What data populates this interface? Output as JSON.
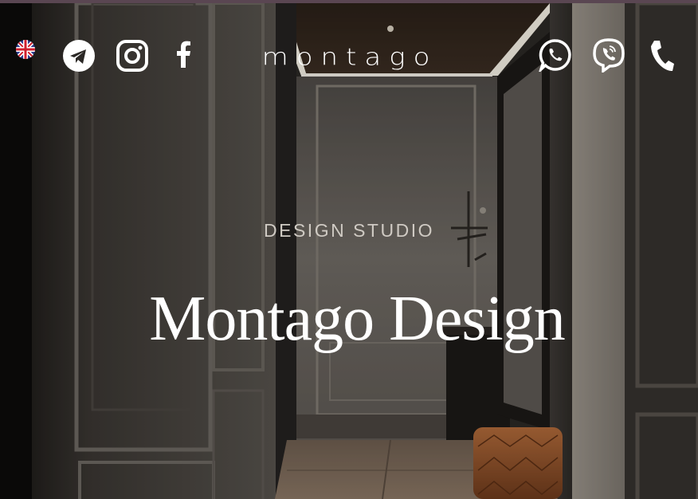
{
  "header": {
    "language": {
      "code": "en",
      "icon": "uk-flag-icon"
    },
    "social": [
      {
        "name": "telegram",
        "icon": "telegram-icon"
      },
      {
        "name": "instagram",
        "icon": "instagram-icon"
      },
      {
        "name": "facebook",
        "icon": "facebook-icon"
      }
    ],
    "logo": "montago",
    "contacts": [
      {
        "name": "whatsapp",
        "icon": "whatsapp-icon"
      },
      {
        "name": "viber",
        "icon": "viber-icon"
      },
      {
        "name": "phone",
        "icon": "phone-icon"
      }
    ]
  },
  "hero": {
    "eyebrow": "DESIGN STUDIO",
    "title": "Montago Design"
  },
  "colors": {
    "top_bar": "#5a4652",
    "text": "#ffffff",
    "eyebrow_text": "#cfcac3"
  }
}
